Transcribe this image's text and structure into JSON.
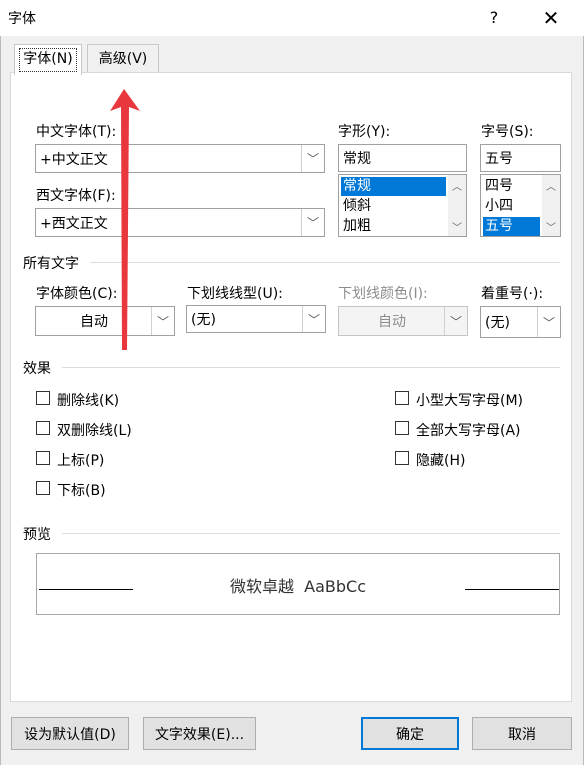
{
  "window": {
    "title": "字体",
    "help": "?",
    "close": "✕"
  },
  "tabs": [
    {
      "label": "字体(N)"
    },
    {
      "label": "高级(V)"
    }
  ],
  "font": {
    "chinese_font_label": "中文字体(T):",
    "chinese_font_value": "+中文正文",
    "western_font_label": "西文字体(F):",
    "western_font_value": "+西文正文",
    "style_label": "字形(Y):",
    "style_value": "常规",
    "style_options": [
      "常规",
      "倾斜",
      "加粗"
    ],
    "size_label": "字号(S):",
    "size_value": "五号",
    "size_options": [
      "四号",
      "小四",
      "五号"
    ]
  },
  "all_text": {
    "group_label": "所有文字",
    "color_label": "字体颜色(C):",
    "color_value": "自动",
    "underline_label": "下划线线型(U):",
    "underline_value": "(无)",
    "underline_color_label": "下划线颜色(I):",
    "underline_color_value": "自动",
    "emphasis_label": "着重号(·):",
    "emphasis_value": "(无)"
  },
  "effects": {
    "group_label": "效果",
    "left": [
      {
        "label": "删除线(K)",
        "checked": false
      },
      {
        "label": "双删除线(L)",
        "checked": false
      },
      {
        "label": "上标(P)",
        "checked": false
      },
      {
        "label": "下标(B)",
        "checked": false
      }
    ],
    "right": [
      {
        "label": "小型大写字母(M)",
        "checked": false
      },
      {
        "label": "全部大写字母(A)",
        "checked": false
      },
      {
        "label": "隐藏(H)",
        "checked": false
      }
    ]
  },
  "preview": {
    "group_label": "预览",
    "sample_text": "微软卓越  AaBbCc"
  },
  "buttons": {
    "set_default": "设为默认值(D)",
    "text_effects": "文字效果(E)...",
    "ok": "确定",
    "cancel": "取消"
  },
  "colors": {
    "selection": "#0078d7",
    "annotation_arrow": "#e8383d"
  }
}
